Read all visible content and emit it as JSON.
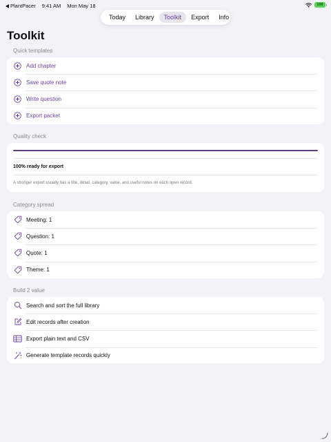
{
  "status_bar": {
    "back_app": "PlantPacer",
    "time": "9:41 AM",
    "date": "Mon May 18",
    "battery": "100"
  },
  "tabs": [
    {
      "label": "Today",
      "active": false
    },
    {
      "label": "Library",
      "active": false
    },
    {
      "label": "Toolkit",
      "active": true
    },
    {
      "label": "Export",
      "active": false
    },
    {
      "label": "Info",
      "active": false
    }
  ],
  "page_title": "Toolkit",
  "quick_templates": {
    "header": "Quick templates",
    "items": [
      {
        "label": "Add chapter",
        "icon": "plus-circle-icon"
      },
      {
        "label": "Save quote note",
        "icon": "plus-circle-icon"
      },
      {
        "label": "Write question",
        "icon": "plus-circle-icon"
      },
      {
        "label": "Export packet",
        "icon": "plus-circle-icon"
      }
    ]
  },
  "quality_check": {
    "header": "Quality check",
    "progress": 1.0,
    "status": "100% ready for export",
    "note": "A stronger export usually has a title, detail, category, value, and useful notes on each open record."
  },
  "category_spread": {
    "header": "Category spread",
    "items": [
      {
        "label": "Meeting: 1",
        "icon": "tag-icon"
      },
      {
        "label": "Question: 1",
        "icon": "tag-icon"
      },
      {
        "label": "Quote: 1",
        "icon": "tag-icon"
      },
      {
        "label": "Theme: 1",
        "icon": "tag-icon"
      }
    ]
  },
  "build_value": {
    "header": "Build 2 value",
    "items": [
      {
        "label": "Search and sort the full library",
        "icon": "magnifier-icon"
      },
      {
        "label": "Edit records after creation",
        "icon": "edit-icon"
      },
      {
        "label": "Export plain text and CSV",
        "icon": "table-icon"
      },
      {
        "label": "Generate template records quickly",
        "icon": "magic-wand-icon"
      }
    ]
  },
  "colors": {
    "accent": "#6a3f9e",
    "background": "#f2f2f7",
    "card": "#ffffff",
    "progress_fill": "#5b3d7e",
    "battery": "#5ad15a"
  }
}
